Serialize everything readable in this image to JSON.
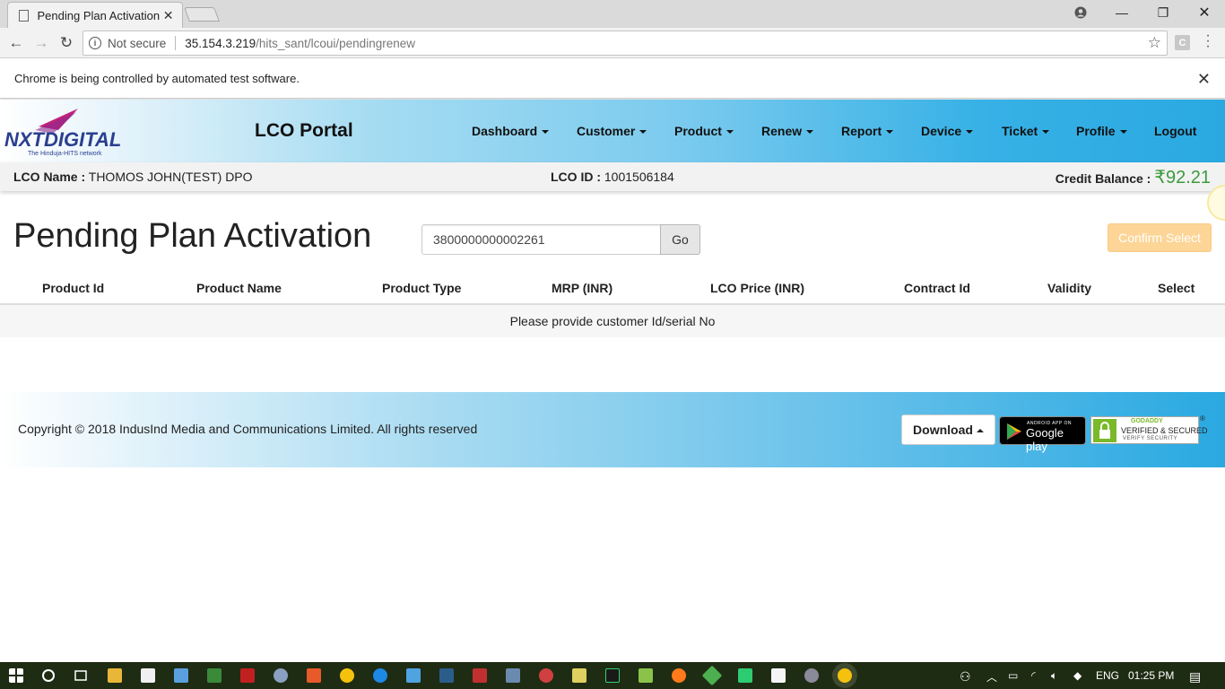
{
  "browser": {
    "tab_title": "Pending Plan Activation",
    "not_secure": "Not secure",
    "url_host": "35.154.3.219",
    "url_path": "/hits_sant/lcoui/pendingrenew",
    "extension_letter": "C",
    "infobar_text": "Chrome is being controlled by automated test software."
  },
  "header": {
    "logo_text": "NXTDIGITAL",
    "logo_tagline": "The Hinduja-HITS network",
    "portal_title": "LCO Portal",
    "nav": [
      "Dashboard",
      "Customer",
      "Product",
      "Renew",
      "Report",
      "Device",
      "Ticket",
      "Profile",
      "Logout"
    ]
  },
  "info": {
    "lco_name_label": "LCO Name :",
    "lco_name": "THOMOS JOHN(TEST) DPO",
    "lco_id_label": "LCO ID :",
    "lco_id": "1001506184",
    "credit_label": "Credit Balance :",
    "credit_amount": "₹92.21"
  },
  "main": {
    "page_title": "Pending Plan Activation",
    "search_value": "3800000000002261",
    "go_label": "Go",
    "confirm_label": "Confirm Select",
    "columns": [
      "Product Id",
      "Product Name",
      "Product Type",
      "MRP (INR)",
      "LCO Price (INR)",
      "Contract Id",
      "Validity",
      "Select"
    ],
    "empty_message": "Please provide customer Id/serial No"
  },
  "footer": {
    "copyright": "Copyright © 2018 IndusInd Media and Communications Limited. All rights reserved",
    "download_label": "Download",
    "gplay_small": "ANDROID APP ON",
    "gplay_big": "Google play",
    "godaddy_line1": "GODADDY",
    "godaddy_line2": "VERIFIED & SECURED",
    "godaddy_line3": "VERIFY SECURITY",
    "reg_mark": "®"
  },
  "taskbar": {
    "language": "ENG",
    "time": "01:25 PM"
  },
  "colors": {
    "accent_blue": "#2aa9e1",
    "credit_green": "#3c9a3c",
    "confirm_orange": "#fcd597",
    "taskbar": "#1f2c14"
  }
}
